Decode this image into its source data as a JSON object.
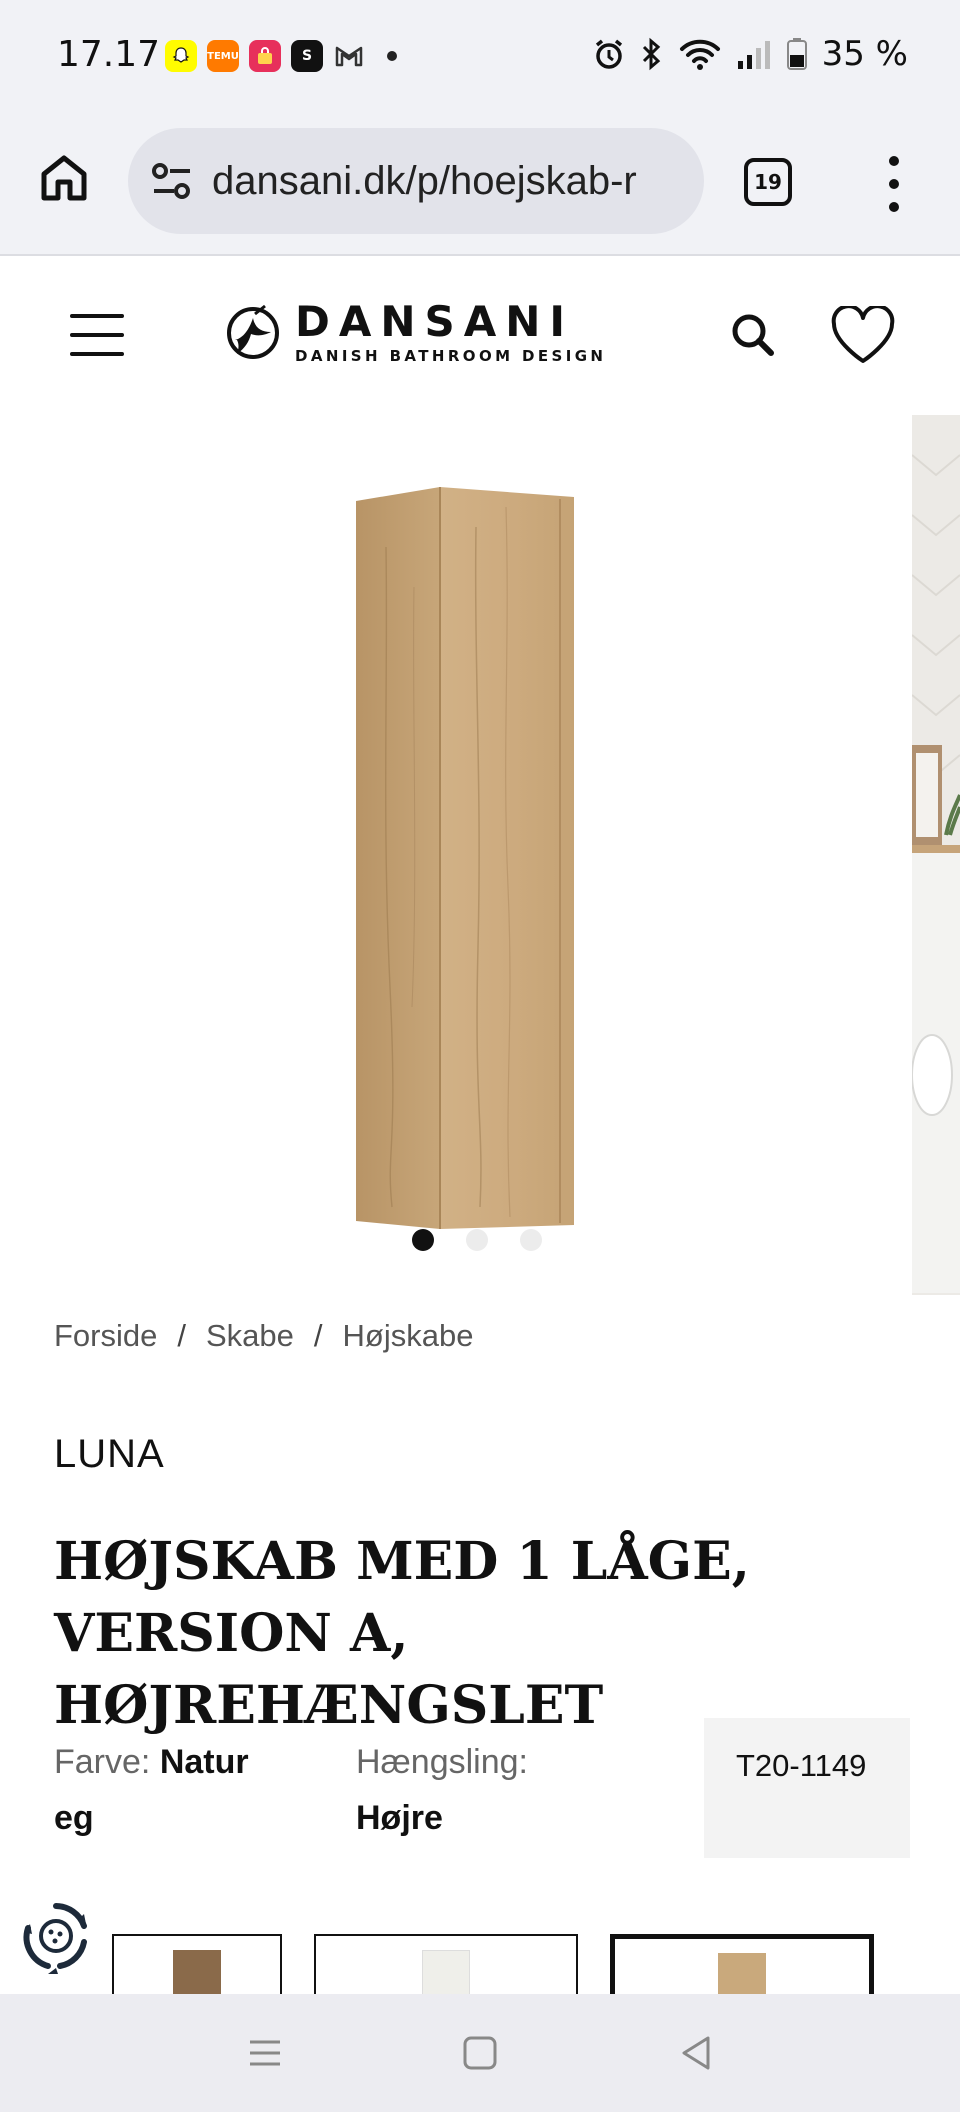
{
  "status_bar": {
    "time": "17.17",
    "battery": "35 %",
    "apps": [
      {
        "name": "snapchat-icon",
        "color": "#fffc00"
      },
      {
        "name": "temu-icon",
        "color": "#ff7a00"
      },
      {
        "name": "shopping-bag-icon",
        "color": "#e7305b"
      },
      {
        "name": "s-app-icon",
        "color": "#111111"
      },
      {
        "name": "gmail-icon",
        "color": "#f1f2f6"
      }
    ]
  },
  "browser": {
    "url": "dansani.dk/p/hoejskab-r",
    "tab_count": "19"
  },
  "site": {
    "logo_name": "DANSANI",
    "logo_tagline": "DANISH BATHROOM DESIGN"
  },
  "carousel": {
    "slides": 3,
    "active_slide": 1
  },
  "breadcrumb": {
    "items": [
      "Forside",
      "Skabe",
      "Højskabe"
    ],
    "separator": "/"
  },
  "product": {
    "brand": "LUNA",
    "title": "HØJSKAB MED 1 LÅGE, VERSION A, HØJREHÆNGSLET",
    "color_label": "Farve:",
    "color_value": "Natur eg",
    "hinge_label": "Hængsling:",
    "hinge_value": "Højre",
    "sku": "T20-1149"
  },
  "variants": [
    {
      "name": "dark oak",
      "swatch": "#8a6a4a",
      "selected": false
    },
    {
      "name": "white",
      "swatch": "#efefea",
      "selected": false
    },
    {
      "name": "natural oak",
      "swatch": "#c9a97c",
      "selected": true
    }
  ],
  "colors": {
    "wood": "#c8a878",
    "text": "#111111",
    "muted": "#666666",
    "chrome_bg": "#f1f2f6"
  }
}
